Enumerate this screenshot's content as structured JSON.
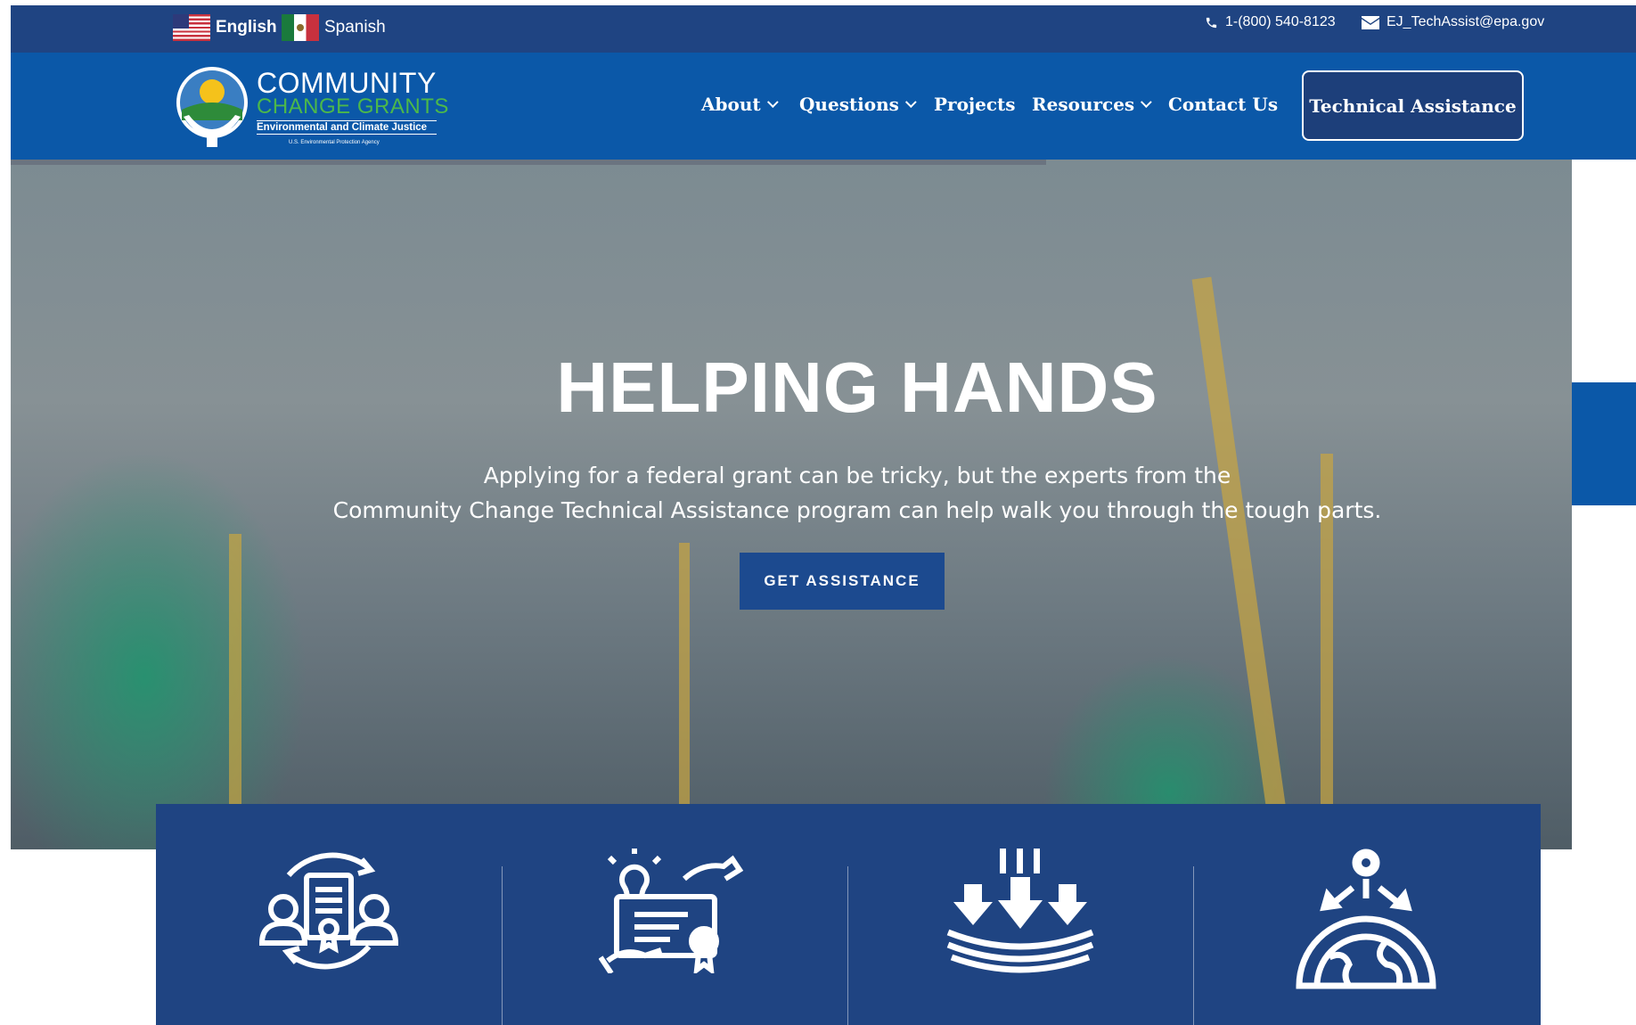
{
  "top_bar": {
    "languages": [
      {
        "label": "English",
        "flag": "us-flag-icon"
      },
      {
        "label": "Spanish",
        "flag": "mexico-flag-icon"
      }
    ],
    "phone": "1-(800) 540-8123",
    "email": "EJ_TechAssist@epa.gov"
  },
  "header": {
    "logo": {
      "line1": "COMMUNITY",
      "line2": "CHANGE GRANTS",
      "line3": "Environmental and Climate Justice",
      "line4": "U.S. Environmental Protection Agency"
    },
    "nav": [
      {
        "label": "About",
        "dropdown": true
      },
      {
        "label": "Questions",
        "dropdown": true
      },
      {
        "label": "Projects",
        "dropdown": false
      },
      {
        "label": "Resources",
        "dropdown": true
      },
      {
        "label": "Contact Us",
        "dropdown": false
      }
    ],
    "cta_label": "Technical Assistance"
  },
  "hero": {
    "title": "HELPING HANDS",
    "subtitle_line1": "Applying for a federal grant can be tricky, but the experts from the",
    "subtitle_line2": "Community Change Technical Assistance program can help walk you through the tough parts.",
    "button_label": "GET ASSISTANCE"
  },
  "features": {
    "icons": [
      "document-exchange-icon",
      "idea-certificate-icon",
      "downward-arrows-icon",
      "globe-gear-icon"
    ]
  },
  "colors": {
    "top_bar": "#1f4482",
    "header": "#0b58a8",
    "button": "#1c4a8f",
    "logo_green": "#4cb84a"
  }
}
